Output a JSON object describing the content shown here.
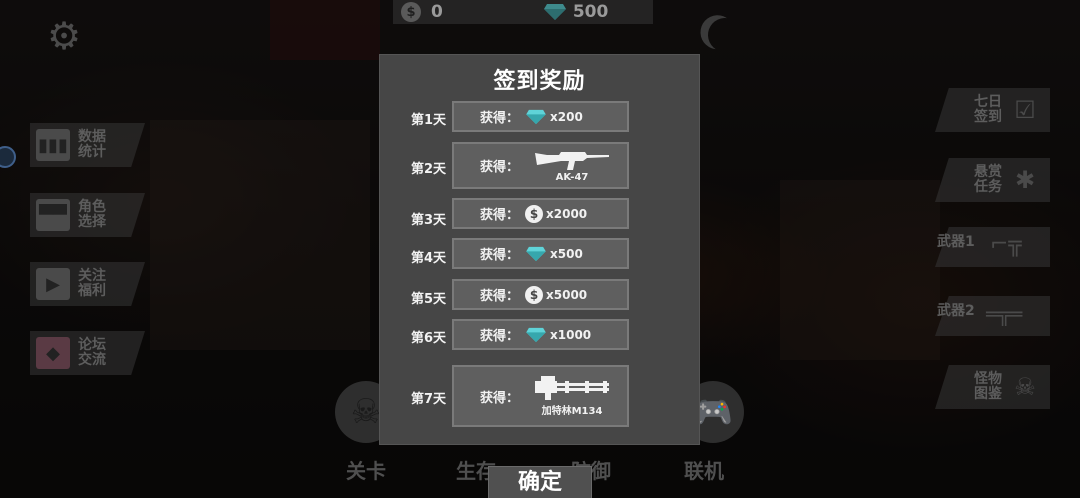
{
  "currency": {
    "coins": "0",
    "gems": "500"
  },
  "left_menu": [
    {
      "label": "数据统计",
      "icon": "bar-chart-icon"
    },
    {
      "label": "角色选择",
      "icon": "face-icon"
    },
    {
      "label": "关注福利",
      "icon": "tv-icon"
    },
    {
      "label": "论坛交流",
      "icon": "forum-icon"
    }
  ],
  "right_menu": {
    "checkin": "七日签到",
    "bounty": "悬赏任务",
    "weapon1": "武器1",
    "weapon2": "武器2",
    "monster": "怪物图鉴"
  },
  "bottom_nav": [
    "关卡",
    "生存",
    "防御",
    "联机"
  ],
  "dialog": {
    "title": "签到奖励",
    "get_label": "获得：",
    "days": [
      {
        "day": "第1天",
        "type": "gem",
        "qty": "x200"
      },
      {
        "day": "第2天",
        "type": "weapon",
        "name": "AK-47"
      },
      {
        "day": "第3天",
        "type": "coin",
        "qty": "x2000"
      },
      {
        "day": "第4天",
        "type": "gem",
        "qty": "x500"
      },
      {
        "day": "第5天",
        "type": "coin",
        "qty": "x5000"
      },
      {
        "day": "第6天",
        "type": "gem",
        "qty": "x1000"
      },
      {
        "day": "第7天",
        "type": "weapon",
        "name": "加特林M134"
      }
    ],
    "confirm": "确定"
  },
  "colors": {
    "gem": "#5fd3d8",
    "panel": "#464646",
    "slot": "#5f5f5f"
  }
}
